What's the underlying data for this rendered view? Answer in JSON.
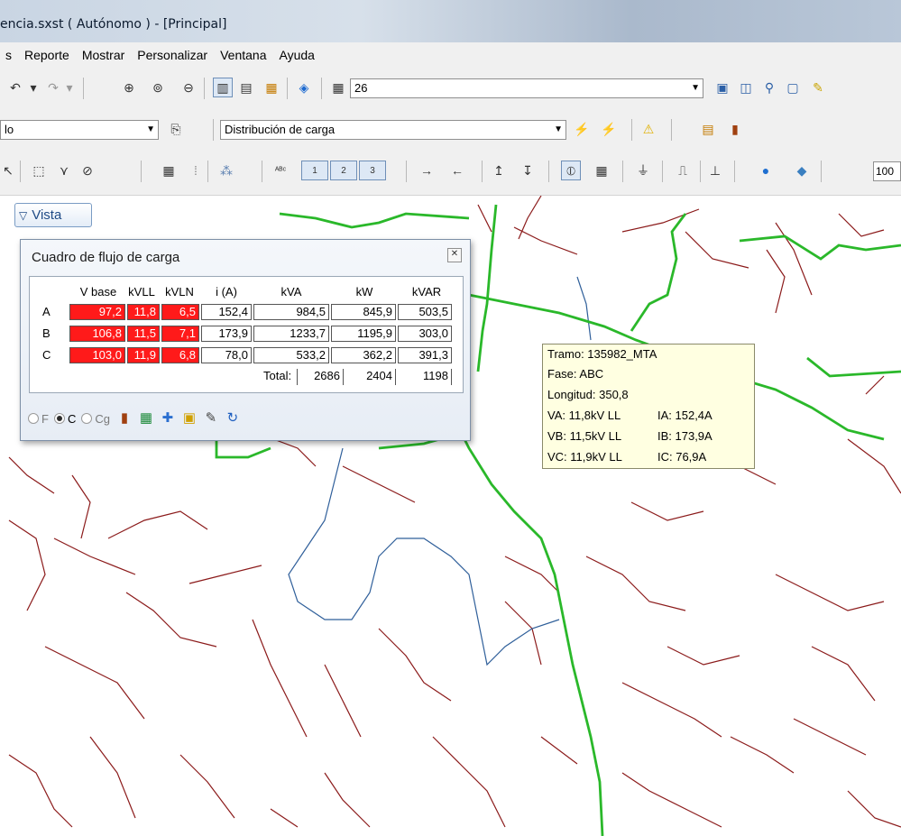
{
  "window": {
    "title": "encia.sxst ( Autónomo ) - [Principal]"
  },
  "menu": [
    "s",
    "Reporte",
    "Mostrar",
    "Personalizar",
    "Ventana",
    "Ayuda"
  ],
  "toolbar1": {
    "combo_value": "26",
    "icons": [
      "undo-icon",
      "dropdown-icon",
      "redo-icon",
      "dropdown-icon",
      "zoom-in-icon",
      "zoom-window-icon",
      "zoom-out-icon",
      "view-layout-icon",
      "view-list-icon",
      "view-report-icon",
      "map-icon",
      "table-icon",
      "properties-icon",
      "open-icon",
      "find-icon",
      "export-icon",
      "highlight-icon"
    ]
  },
  "toolbar2": {
    "left_combo_value": "lo",
    "analysis_combo_value": "Distribución de carga",
    "icons": [
      "browse-icon",
      "run-icon",
      "run-all-icon",
      "warning-icon",
      "report-icon",
      "chart-icon"
    ]
  },
  "toolbar3": {
    "zoom_value": "100",
    "icons": [
      "select-icon",
      "box-select-icon",
      "branch-select-icon",
      "clear-select-icon",
      "grid-icon",
      "small-grid-icon",
      "network-icon",
      "abc-icon",
      "label1-icon",
      "label2-icon",
      "label3-icon",
      "arrow-right-icon",
      "arrow-left-icon",
      "up-icon",
      "down-icon",
      "meter-icon",
      "grid-dense-icon",
      "transformer-icon",
      "switch-icon",
      "bus-icon",
      "globe-icon",
      "layers-icon"
    ]
  },
  "vista_tab": {
    "label": "Vista"
  },
  "panel": {
    "title": "Cuadro de flujo de carga",
    "headers": [
      "V base",
      "kVLL",
      "kVLN",
      "i (A)",
      "kVA",
      "kW",
      "kVAR"
    ],
    "rows": [
      {
        "phase": "A",
        "vbase": "97,2",
        "kvll": "11,8",
        "kvln": "6,5",
        "i": "152,4",
        "kva": "984,5",
        "kw": "845,9",
        "kvar": "503,5"
      },
      {
        "phase": "B",
        "vbase": "106,8",
        "kvll": "11,5",
        "kvln": "7,1",
        "i": "173,9",
        "kva": "1233,7",
        "kw": "1195,9",
        "kvar": "303,0"
      },
      {
        "phase": "C",
        "vbase": "103,0",
        "kvll": "11,9",
        "kvln": "6,8",
        "i": "78,0",
        "kva": "533,2",
        "kw": "362,2",
        "kvar": "391,3"
      }
    ],
    "total_label": "Total:",
    "totals": {
      "kva": "2686",
      "kw": "2404",
      "kvar": "1198"
    },
    "radios": [
      {
        "label": "F",
        "selected": false
      },
      {
        "label": "C",
        "selected": true
      },
      {
        "label": "Cg",
        "selected": false
      }
    ],
    "alert_color": "#ff1a1a"
  },
  "tooltip": {
    "tramo": "Tramo: 135982_MTA",
    "fase": "Fase: ABC",
    "longitud": "Longitud: 350,8",
    "va": "VA: 11,8kV LL",
    "ia": "IA: 152,4A",
    "vb": "VB: 11,5kV LL",
    "ib": "IB: 173,9A",
    "vc": "VC: 11,9kV LL",
    "ic": "IC: 76,9A"
  },
  "map_colors": {
    "three_phase": "#2ab82a",
    "single_phase": "#8b1a1a",
    "two_phase": "#2f5f9a"
  }
}
